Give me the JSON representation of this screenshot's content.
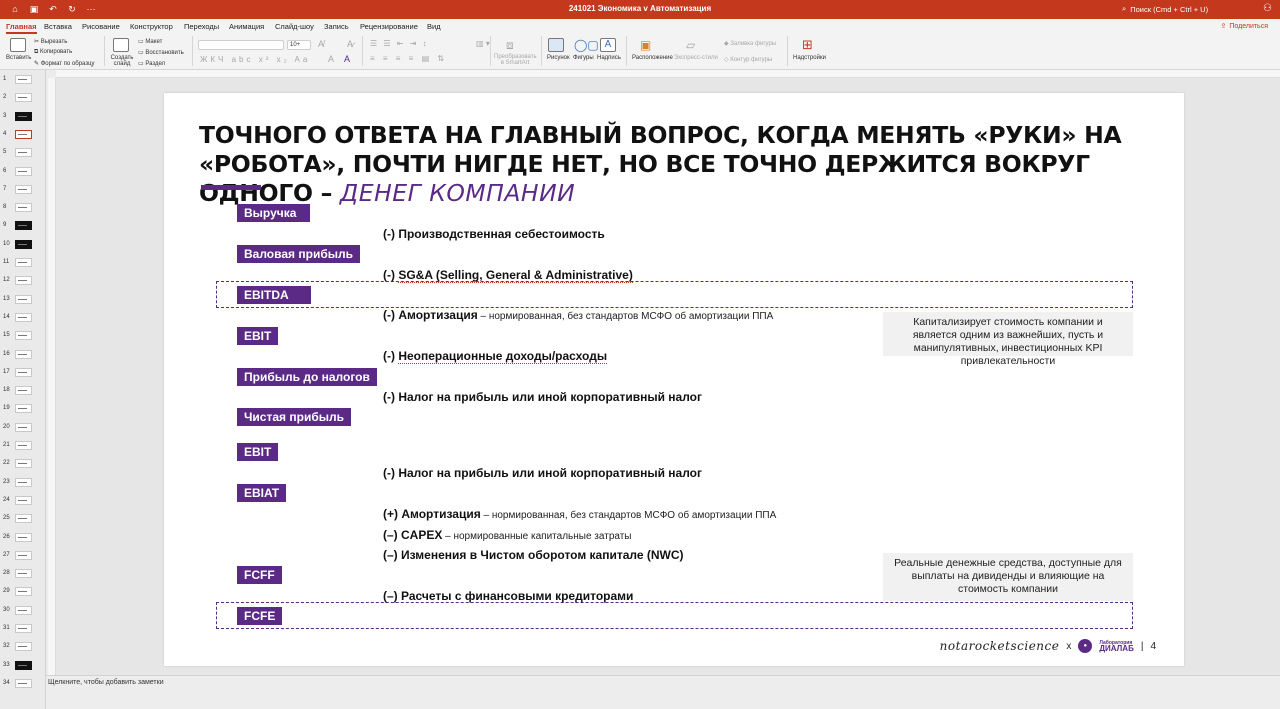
{
  "window": {
    "title": "241021 Экономика v Автоматизация",
    "search_placeholder": "Поиск (Cmd + Ctrl + U)"
  },
  "menu": {
    "tabs": [
      "Главная",
      "Вставка",
      "Рисование",
      "Конструктор",
      "Переходы",
      "Анимация",
      "Слайд-шоу",
      "Запись",
      "Рецензирование",
      "Вид"
    ],
    "active_tab": "Главная",
    "share_label": "Поделиться"
  },
  "ribbon": {
    "paste": "Вставить",
    "cut": "Вырезать",
    "copy": "Копировать",
    "format_painter": "Формат по образцу",
    "new_slide": "Создать слайд",
    "layout": "Макет",
    "reset": "Восстановить",
    "section": "Раздел",
    "font_size": "10+",
    "convert_smartart": "Преобразовать в SmartArt",
    "picture": "Рисунок",
    "shapes": "Фигуры",
    "textbox": "Надпись",
    "arrange": "Расположение",
    "quick_styles": "Экспресс-стили",
    "shape_fill": "Заливка фигуры",
    "shape_outline": "Контур фигуры",
    "addins": "Надстройки"
  },
  "thumbnails": {
    "numbers": [
      "1",
      "2",
      "3",
      "4",
      "5",
      "6",
      "7",
      "8",
      "9",
      "10",
      "11",
      "12",
      "13",
      "14",
      "15",
      "16",
      "17",
      "18",
      "19",
      "20",
      "21",
      "22",
      "23",
      "24",
      "25",
      "26",
      "27",
      "28",
      "29",
      "30",
      "31",
      "32",
      "33",
      "34"
    ],
    "active": "4"
  },
  "slide": {
    "title_main": "ТОЧНОГО ОТВЕТА НА ГЛАВНЫЙ ВОПРОС, КОГДА МЕНЯТЬ «РУКИ» НА «РОБОТА», ПОЧТИ НИГДЕ НЕТ, НО ВСЕ ТОЧНО ДЕРЖИТСЯ ВОКРУГ ОДНОГО – ",
    "title_highlight": "ДЕНЕГ КОМПАНИИ",
    "tags": {
      "revenue": "Выручка",
      "gross_profit": "Валовая прибыль",
      "ebitda": "EBITDA",
      "ebit": "EBIT",
      "pretax": "Прибыль до налогов",
      "net": "Чистая прибыль",
      "ebit2": "EBIT",
      "ebiat": "EBIAT",
      "fcff": "FCFF",
      "fcfe": "FCFE"
    },
    "lines": {
      "cogs": "(-) Производственная себестоимость",
      "sga_prefix": "(-) ",
      "sga": "SG&A (Selling, General & Administrative)",
      "amort_head": "(-) Амортизация",
      "amort_note": " – нормированная, без стандартов МСФО об амортизации ППА",
      "nonop_prefix": "(-) ",
      "nonop": "Неоперационные доходы/расходы",
      "tax1": "(-) Налог на прибыль или иной корпоративный налог",
      "tax2": "(-) Налог на прибыль или иной корпоративный налог",
      "amort2_head": "(+) Амортизация",
      "amort2_note": " – нормированная, без стандартов МСФО об амортизации ППА",
      "capex_head": "(–) CAPEX",
      "capex_note": " – нормированные капитальные затраты",
      "nwc": "(–) Изменения в Чистом оборотом капитале (NWC)",
      "creditors": "(–) Расчеты с финансовыми кредиторами"
    },
    "callouts": {
      "ebitda": "Капитализирует стоимость компании и является одним из важнейших, пусть и манипулятивных, инвестиционных KPI привлекательности",
      "fcfe": "Реальные денежные средства, доступные для выплаты на дивиденды и влияющие на стоимость компании"
    },
    "footer": {
      "brand": "notarocketscience",
      "x": "x",
      "lab_small": "Лаборатория",
      "lab_name": "ДИАЛАБ",
      "sep": "|",
      "page": "4"
    }
  },
  "notes": {
    "placeholder": "Щелкните, чтобы добавить заметки"
  }
}
